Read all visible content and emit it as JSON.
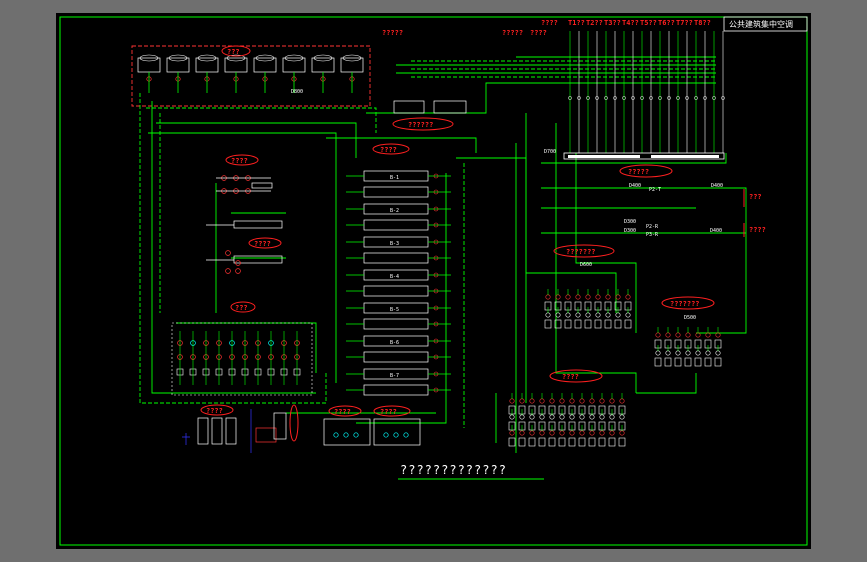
{
  "drawing": {
    "title_block": "公共建筑集中空调",
    "caption": "?????????????",
    "header_codes": [
      "????",
      "T1??",
      "T2??",
      "T3??",
      "T4??",
      "T5??",
      "T6??",
      "T7??",
      "T8??"
    ],
    "callouts": {
      "cooling_towers": "???",
      "pipe_top_left": "?????",
      "pipe_top_mid": "?????",
      "pipe_top_mid2": "????",
      "manifold": "??????",
      "chillers": "????",
      "pump_a": "????",
      "pump_b": "????",
      "pump_c": "???",
      "right_panel": "?????",
      "ahu_group_1": "???????",
      "ahu_group_2": "???????",
      "fcu_group": "????",
      "tank_1": "????",
      "tank_2": "????",
      "tank_3": "????",
      "return_1": "???",
      "return_2": "????"
    },
    "pipe_labels": {
      "d700_top": "D700",
      "d400_a": "D400",
      "d400_b": "D400",
      "d300_a": "D300",
      "d300_b": "D300",
      "d600": "D600",
      "d500": "D500",
      "d800": "D800",
      "d400_c": "D400"
    },
    "loop_labels": {
      "p2t": "P2-T",
      "p2r": "P2-R",
      "p3r": "P3-R"
    },
    "chiller_units": [
      "B-1",
      "B-2",
      "B-3",
      "B-4",
      "B-5",
      "B-6",
      "B-7"
    ],
    "colors": {
      "background": "#000000",
      "frame": "#00ff00",
      "pipe": "#00ff00",
      "text": "#ffffff",
      "highlight": "#ff2020",
      "equipment_red": "#ff3333",
      "equipment_cyan": "#00ffff",
      "equipment_blue": "#3333ff"
    }
  }
}
